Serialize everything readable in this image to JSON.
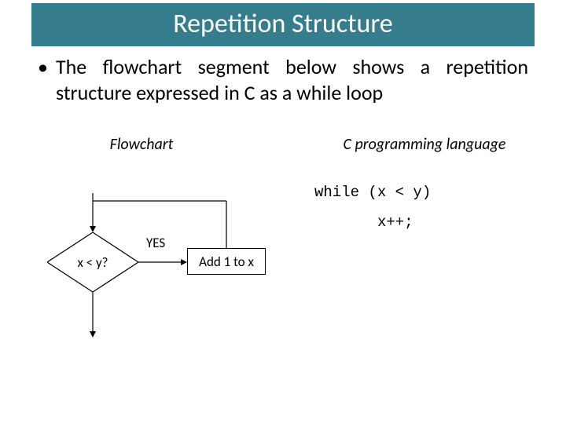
{
  "title": "Repetition Structure",
  "bullet": {
    "mark": "•",
    "text": "The flowchart segment below shows a repetition structure expressed in C as a while loop"
  },
  "columns": {
    "left_header": "Flowchart",
    "right_header": "C  programming language"
  },
  "flowchart": {
    "decision": "x < y?",
    "yes_label": "YES",
    "process": "Add 1 to x"
  },
  "code": {
    "line1": "while (x < y)",
    "line2": "x++;"
  }
}
